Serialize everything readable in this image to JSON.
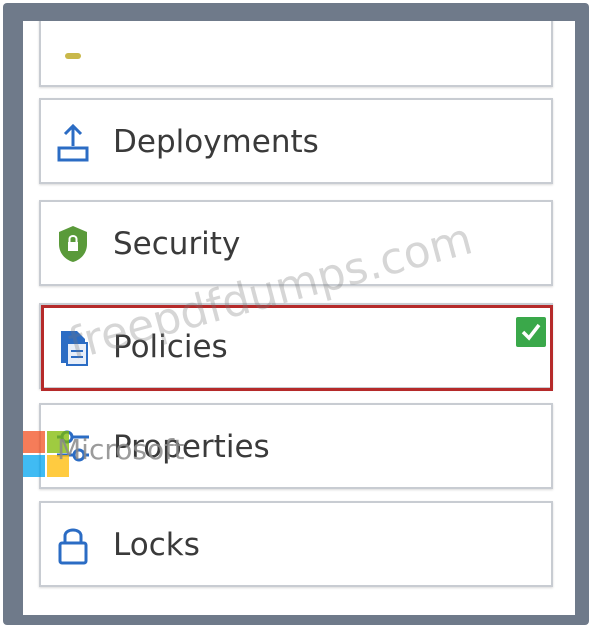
{
  "menu": {
    "items": [
      {
        "label": "",
        "icon": "partial-icon"
      },
      {
        "label": "Deployments",
        "icon": "upload-icon"
      },
      {
        "label": "Security",
        "icon": "shield-icon"
      },
      {
        "label": "Policies",
        "icon": "document-icon",
        "selected": true
      },
      {
        "label": "Properties",
        "icon": "sliders-icon"
      },
      {
        "label": "Locks",
        "icon": "lock-icon"
      }
    ]
  },
  "overlay": {
    "brand_text": "Microsoft",
    "watermark_text": "freepdfdumps.com"
  },
  "colors": {
    "frame": "#6f7a8a",
    "selection": "#b52a2a",
    "check": "#3aa84a",
    "shield": "#5a9a3a",
    "icon_blue": "#2b6cc4"
  }
}
